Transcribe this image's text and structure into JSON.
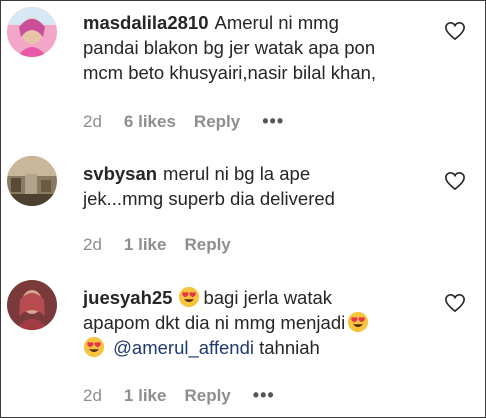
{
  "comments": [
    {
      "username": "masdalila2810",
      "text_line1": "Amerul ni mmg",
      "text_line2": "pandai blakon bg jer watak apa pon",
      "text_line3": "mcm beto khusyairi,nasir bilal khan,",
      "age": "2d",
      "likes": "6 likes",
      "reply": "Reply",
      "more": "•••"
    },
    {
      "username": "svbysan",
      "text_line1": "merul ni bg la ape",
      "text_line2": "jek...mmg superb dia delivered",
      "age": "2d",
      "likes": "1 like",
      "reply": "Reply"
    },
    {
      "username": "juesyah25",
      "text_line1": "bagi jerla watak",
      "text_line2": "apapom dkt dia ni mmg menjadi",
      "mention": "@amerul_affendi",
      "text_line3_end": "tahniah",
      "age": "2d",
      "likes": "1 like",
      "reply": "Reply",
      "more": "•••"
    }
  ],
  "colors": {
    "text": "#262626",
    "secondary": "#8e8e8e",
    "mention": "#1e3a6e",
    "emoji_face": "#f7c440",
    "emoji_eyes": "#e8334a"
  },
  "icons": {
    "like": "heart-outline-icon",
    "emoji": "heart-eyes-emoji",
    "more": "more-options-icon"
  }
}
